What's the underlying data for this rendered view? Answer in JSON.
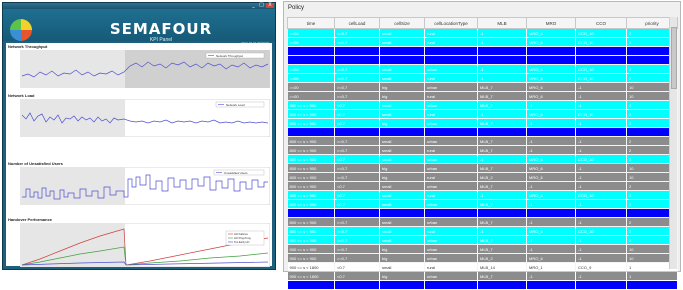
{
  "kpi_window": {
    "controls": {
      "minimize": "_",
      "maximize": "□",
      "close": "X"
    },
    "app_title": "SEMAFOUR",
    "app_subtitle": "KPI Panel",
    "timestamp": "2014-01-01 00:00:00",
    "panels": [
      {
        "title": "Network Throughput",
        "legend": "Network Throughput",
        "color": "#4f4fd0"
      },
      {
        "title": "Network Load",
        "legend": "Network Load",
        "color": "#4f4fd0"
      },
      {
        "title": "Number of Unsatisfied Users",
        "legend": "Unsatisfied Users",
        "color": "#4f4fd0"
      },
      {
        "title": "Handover Performance",
        "legend_items": [
          "HO Failures",
          "HO Ping-Pong",
          "Too Early HO"
        ],
        "colors": [
          "#d04040",
          "#40a040",
          "#4f4fd0"
        ]
      }
    ]
  },
  "policy": {
    "label": "Policy",
    "columns": [
      "time",
      "cellLoad",
      "cellSize",
      "cellLocationType",
      "MLB",
      "MRO",
      "CCO",
      "priority"
    ],
    "rows": [
      {
        "style": "cyan",
        "cells": [
          ">=00",
          "<=0.7",
          "small",
          "rural",
          "-1",
          "MRO_6",
          "CCO_10",
          "2"
        ]
      },
      {
        "style": "cyan",
        "cells": [
          ">=00",
          "<=0.7",
          "small",
          "rural",
          "-1",
          "MRO_6",
          "CCO_10",
          "2"
        ]
      },
      {
        "style": "blue",
        "cells": [
          "",
          "",
          "",
          "",
          "",
          "",
          "",
          ""
        ]
      },
      {
        "style": "blue",
        "cells": [
          "",
          "",
          "",
          "",
          "",
          "",
          "",
          ""
        ]
      },
      {
        "style": "cyan",
        "cells": [
          ">=00",
          ">=0.7",
          "small",
          "urban",
          "-1",
          "MRO_6",
          "CCO_10",
          "2"
        ]
      },
      {
        "style": "cyan",
        "cells": [
          ">=00",
          ">=0.7",
          "small",
          "rural",
          "-1",
          "MRO_6",
          "CCO_10",
          "2"
        ]
      },
      {
        "style": "gray",
        "cells": [
          ">=00",
          ">=0.7",
          "big",
          "urban",
          "MLB_7",
          "MRO_6",
          "-1",
          "10"
        ]
      },
      {
        "style": "gray",
        "cells": [
          ">=00",
          ">=0.7",
          "big",
          "rural",
          "MLB_7",
          "MRO_6",
          "-1",
          "10"
        ]
      },
      {
        "style": "cyan",
        "cells": [
          "800 <= s < 900",
          "<0.7",
          "small",
          "urban",
          "MLB_7",
          "-1",
          "-1",
          "2"
        ]
      },
      {
        "style": "cyan",
        "cells": [
          "800 <= s < 900",
          "<0.7",
          "small",
          "rural",
          "-1",
          "MRO_6",
          "CCO_10",
          "2"
        ]
      },
      {
        "style": "cyan",
        "cells": [
          "800 <= s < 900",
          "<0.7",
          "big",
          "urban",
          "MLB_7",
          "-1",
          "-1",
          "2"
        ]
      },
      {
        "style": "blue",
        "cells": [
          "",
          "",
          "",
          "",
          "",
          "",
          "",
          ""
        ]
      },
      {
        "style": "gray",
        "cells": [
          "800 <= s < 900",
          ">=0.7",
          "small",
          "urban",
          "MLB_7",
          "-1",
          "-1",
          "2"
        ]
      },
      {
        "style": "gray",
        "cells": [
          "800 <= s < 900",
          ">=0.7",
          "small",
          "rural",
          "MLB_7",
          "-1",
          "-1",
          "2"
        ]
      },
      {
        "style": "cyan",
        "cells": [
          "800 <= s < 900",
          "<0.7",
          "small",
          "urban",
          "-1",
          "MRO_6",
          "CCO_10",
          "2"
        ]
      },
      {
        "style": "gray",
        "cells": [
          "800 <= s < 900",
          ">=0.7",
          "big",
          "urban",
          "MLB_7",
          "MRO_6",
          "-1",
          "10"
        ]
      },
      {
        "style": "gray",
        "cells": [
          "800 <= s < 900",
          ">=0.7",
          "big",
          "rural",
          "MLB_2",
          "MRO_6",
          "-1",
          "10"
        ]
      },
      {
        "style": "gray",
        "cells": [
          "800 <= s < 900",
          "<0.7",
          "small",
          "urban",
          "MLB_7",
          "-1",
          "-1",
          "2"
        ]
      },
      {
        "style": "cyan",
        "cells": [
          "800 <= s < 900",
          "<0.7",
          "small",
          "rural",
          "-1",
          "MRO_6",
          "CCO_10",
          "2"
        ]
      },
      {
        "style": "cyan",
        "cells": [
          "800 <= s < 900",
          "<0.7",
          "small",
          "urban",
          "MLB_7",
          "-1",
          "-1",
          "2"
        ]
      },
      {
        "style": "blue",
        "cells": [
          "",
          "",
          "",
          "",
          "",
          "",
          "",
          ""
        ]
      },
      {
        "style": "gray",
        "cells": [
          "800 <= s < 900",
          ">=0.7",
          "small",
          "urban",
          "MLB_7",
          "-1",
          "-1",
          "2"
        ]
      },
      {
        "style": "cyan",
        "cells": [
          "800 <= s < 900",
          ">=0.7",
          "small",
          "rural",
          "-1",
          "MRO_6",
          "CCO_10",
          "2"
        ]
      },
      {
        "style": "cyan",
        "cells": [
          "900 <= s < 900",
          ">=0.7",
          "small",
          "urban",
          "MLB_7",
          "-1",
          "-1",
          "2"
        ]
      },
      {
        "style": "gray",
        "cells": [
          "900 <= s < 900",
          ">=0.7",
          "big",
          "urban",
          "MLB_7",
          "-1",
          "-1",
          "10"
        ]
      },
      {
        "style": "gray",
        "cells": [
          "900 <= s < 900",
          ">=0.7",
          "big",
          "urban",
          "MLB_2",
          "MRO_6",
          "-1",
          "10"
        ]
      },
      {
        "style": "white",
        "cells": [
          "900 <= s < 1800",
          "<0.7",
          "small",
          "rural",
          "MLB_14",
          "MRO_1",
          "CCO_9",
          "1"
        ]
      },
      {
        "style": "gray",
        "cells": [
          "900 <= s < 1800",
          "<0.7",
          "big",
          "urban",
          "MLB_7",
          "-1",
          "-1",
          "1"
        ]
      },
      {
        "style": "blue",
        "cells": [
          "",
          "",
          "",
          "",
          "",
          "",
          "",
          ""
        ]
      }
    ]
  }
}
